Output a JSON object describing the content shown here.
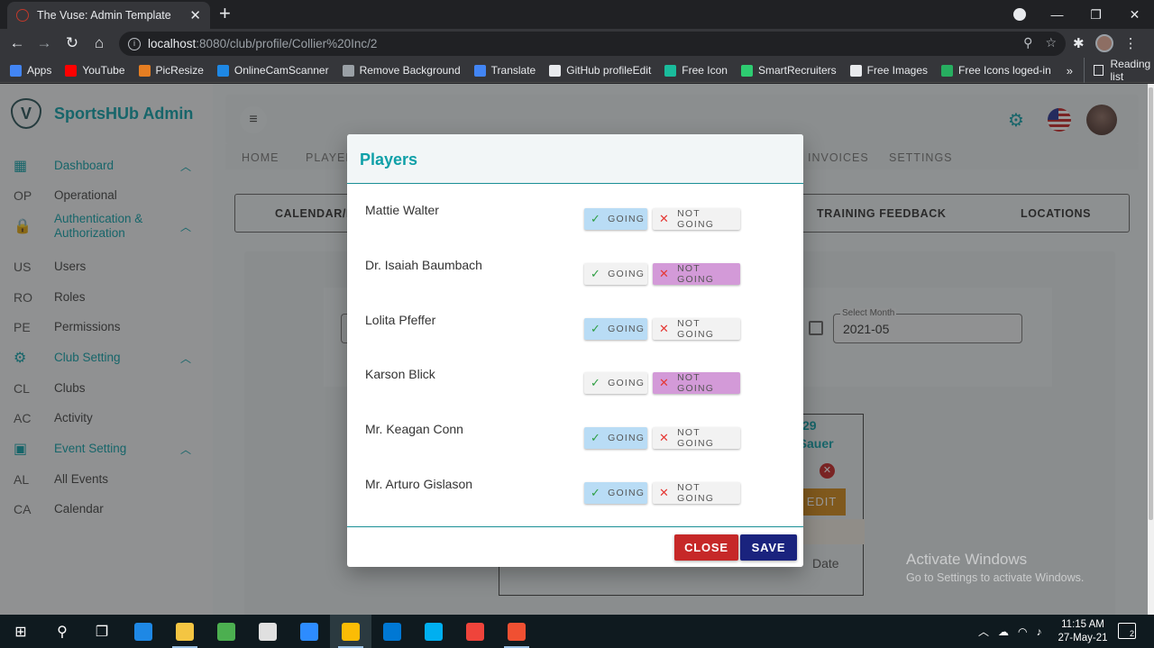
{
  "browser": {
    "tab_title": "The Vuse: Admin Template",
    "url_host": "localhost",
    "url_path": ":8080/club/profile/Collier%20Inc/2",
    "bookmarks": [
      {
        "label": "Apps",
        "color": "#4285f4"
      },
      {
        "label": "YouTube",
        "color": "#ff0000"
      },
      {
        "label": "PicResize",
        "color": "#e67e22"
      },
      {
        "label": "OnlineCamScanner",
        "color": "#1e88e5"
      },
      {
        "label": "Remove Background",
        "color": "#9aa0a6"
      },
      {
        "label": "Translate",
        "color": "#4285f4"
      },
      {
        "label": "GitHub profileEdit",
        "color": "#e8eaed"
      },
      {
        "label": "Free Icon",
        "color": "#1abc9c"
      },
      {
        "label": "SmartRecruiters",
        "color": "#2ecc71"
      },
      {
        "label": "Free Images",
        "color": "#e8eaed"
      },
      {
        "label": "Free Icons loged-in",
        "color": "#27ae60"
      }
    ],
    "more_bookmarks": "»",
    "reading_list": "Reading list"
  },
  "sidebar": {
    "brand": "SportsHUb Admin",
    "items": [
      {
        "type": "group",
        "label": "Dashboard",
        "icon": "dashboard-icon"
      },
      {
        "type": "item",
        "abbr": "OP",
        "label": "Operational"
      },
      {
        "type": "group",
        "label": "Authentication & Authorization",
        "icon": "lock-icon"
      },
      {
        "type": "item",
        "abbr": "US",
        "label": "Users"
      },
      {
        "type": "item",
        "abbr": "RO",
        "label": "Roles"
      },
      {
        "type": "item",
        "abbr": "PE",
        "label": "Permissions"
      },
      {
        "type": "group",
        "label": "Club Setting",
        "icon": "gear-icon"
      },
      {
        "type": "item",
        "abbr": "CL",
        "label": "Clubs"
      },
      {
        "type": "item",
        "abbr": "AC",
        "label": "Activity"
      },
      {
        "type": "group",
        "label": "Event Setting",
        "icon": "calendar-icon"
      },
      {
        "type": "item",
        "abbr": "AL",
        "label": "All Events"
      },
      {
        "type": "item",
        "abbr": "CA",
        "label": "Calendar"
      }
    ]
  },
  "main": {
    "menu": [
      "HOME",
      "PLAYER",
      "INVOICES",
      "SETTINGS"
    ],
    "tabs": [
      "CALENDAR/H",
      "TRAINING FEEDBACK",
      "LOCATIONS"
    ],
    "select_month_label": "Select Month",
    "select_month_value": "2021-05",
    "event_day": "29",
    "event_name": "e Sauer",
    "event_edit": "EDIT",
    "event_date": "Date"
  },
  "modal": {
    "title": "Players",
    "going_label": "GOING",
    "not_going_label": "NOT GOING",
    "players": [
      {
        "name": "Mattie Walter",
        "status": "going"
      },
      {
        "name": "Dr. Isaiah Baumbach",
        "status": "not_going"
      },
      {
        "name": "Lolita Pfeffer",
        "status": "going"
      },
      {
        "name": "Karson Blick",
        "status": "not_going"
      },
      {
        "name": "Mr. Keagan Conn",
        "status": "going"
      },
      {
        "name": "Mr. Arturo Gislason",
        "status": "going"
      }
    ],
    "close_label": "CLOSE",
    "save_label": "SAVE",
    "colors": {
      "going_active": "#b9dcf5",
      "not_going_active": "#d39ad8",
      "inactive": "#f2f2f2"
    }
  },
  "watermark": {
    "line1": "Activate Windows",
    "line2": "Go to Settings to activate Windows."
  },
  "taskbar": {
    "time": "11:15 AM",
    "date": "27-May-21",
    "notifications": "2"
  }
}
